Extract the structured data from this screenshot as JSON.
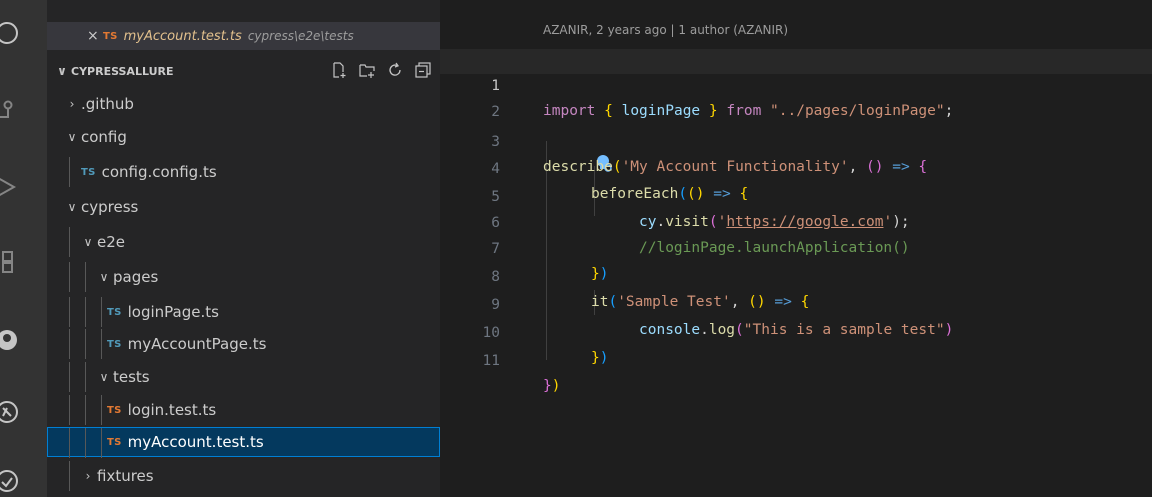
{
  "open_editor": {
    "close": "×",
    "badge": "TS",
    "filename": "myAccount.test.ts",
    "path": "cypress\\e2e\\tests"
  },
  "explorer": {
    "title": "CYPRESSALLURE",
    "chevron": "∨",
    "actions": [
      "new-file-icon",
      "new-folder-icon",
      "refresh-icon",
      "collapse-all-icon"
    ]
  },
  "tree": [
    {
      "label": ".github",
      "type": "folder",
      "expanded": false,
      "depth": 0
    },
    {
      "label": "config",
      "type": "folder",
      "expanded": true,
      "depth": 0
    },
    {
      "label": "config.config.ts",
      "type": "ts",
      "depth": 1
    },
    {
      "label": "cypress",
      "type": "folder",
      "expanded": true,
      "depth": 0
    },
    {
      "label": "e2e",
      "type": "folder",
      "expanded": true,
      "depth": 1
    },
    {
      "label": "pages",
      "type": "folder",
      "expanded": true,
      "depth": 2
    },
    {
      "label": "loginPage.ts",
      "type": "ts",
      "depth": 3
    },
    {
      "label": "myAccountPage.ts",
      "type": "ts",
      "depth": 3
    },
    {
      "label": "tests",
      "type": "folder",
      "expanded": true,
      "depth": 2
    },
    {
      "label": "login.test.ts",
      "type": "ts-test",
      "depth": 3
    },
    {
      "label": "myAccount.test.ts",
      "type": "ts-test",
      "depth": 3,
      "selected": true
    },
    {
      "label": "fixtures",
      "type": "folder",
      "expanded": false,
      "depth": 1
    }
  ],
  "editor": {
    "blame": "AZANIR, 2 years ago | 1 author (AZANIR)",
    "line_numbers": [
      "1",
      "2",
      "3",
      "4",
      "5",
      "6",
      "7",
      "8",
      "9",
      "10",
      "11"
    ],
    "active_line": "1",
    "code": {
      "l1_import": "import",
      "l1_open": "{",
      "l1_name": "loginPage",
      "l1_close": "}",
      "l1_from": "from",
      "l1_path": "\"../pages/loginPage\"",
      "l1_semi": ";",
      "l3_describe": "describe",
      "l3_paren": "(",
      "l3_title": "'My Account Functionality'",
      "l3_comma": ", ",
      "l3_arrowparens": "()",
      "l3_arrow": " => ",
      "l3_brace": "{",
      "l4_before": "beforeEach",
      "l4_paren": "(",
      "l4_arrowparens": "()",
      "l4_arrow": " => ",
      "l4_brace": "{",
      "l5_cy": "cy",
      "l5_dot": ".",
      "l5_visit": "visit",
      "l5_paren": "(",
      "l5_q1": "'",
      "l5_url": "https://google.com",
      "l5_q2": "'",
      "l5_end": ");",
      "l6_comment": "//loginPage.launchApplication()",
      "l7_close_brace": "}",
      "l7_close_paren": ")",
      "l8_it": "it",
      "l8_paren": "(",
      "l8_title": "'Sample Test'",
      "l8_comma": ", ",
      "l8_arrowparens": "()",
      "l8_arrow": " => ",
      "l8_brace": "{",
      "l9_console": "console",
      "l9_dot": ".",
      "l9_log": "log",
      "l9_paren": "(",
      "l9_msg": "\"This is a sample test\"",
      "l9_end": ")",
      "l10_close_brace": "}",
      "l10_close_paren": ")",
      "l11_close_brace": "}",
      "l11_close_paren": ")"
    }
  },
  "colors": {
    "selection": "#04395e",
    "ts_blue": "#519aba",
    "ts_orange": "#e37933"
  }
}
